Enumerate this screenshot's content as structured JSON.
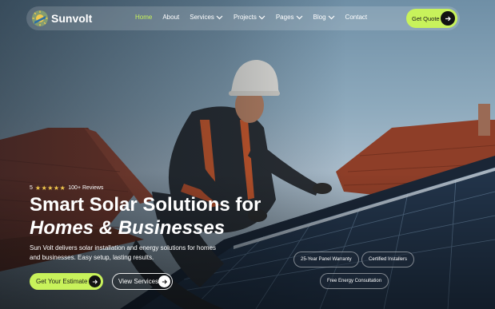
{
  "brand": {
    "name": "Sunvolt",
    "accent": "#c8f25b"
  },
  "nav": {
    "items": [
      {
        "label": "Home",
        "active": true,
        "dropdown": false
      },
      {
        "label": "About",
        "active": false,
        "dropdown": false
      },
      {
        "label": "Services",
        "active": false,
        "dropdown": true
      },
      {
        "label": "Projects",
        "active": false,
        "dropdown": true
      },
      {
        "label": "Pages",
        "active": false,
        "dropdown": true
      },
      {
        "label": "Blog",
        "active": false,
        "dropdown": true
      },
      {
        "label": "Contact",
        "active": false,
        "dropdown": false
      }
    ],
    "cta_label": "Get Quote"
  },
  "hero": {
    "rating_value": "5",
    "stars": "★★★★★",
    "reviews": "100+ Reviews",
    "title_line1": "Smart Solar Solutions for",
    "title_line2": "Homes & Businesses",
    "description": "Sun Volt delivers solar installation and energy solutions for homes and businesses. Easy setup, lasting results.",
    "primary_button": "Get Your Estimate",
    "secondary_button": "View Services"
  },
  "badges": [
    "25-Year Panel Warranty",
    "Certified Installers",
    "Free Energy Consultation"
  ]
}
